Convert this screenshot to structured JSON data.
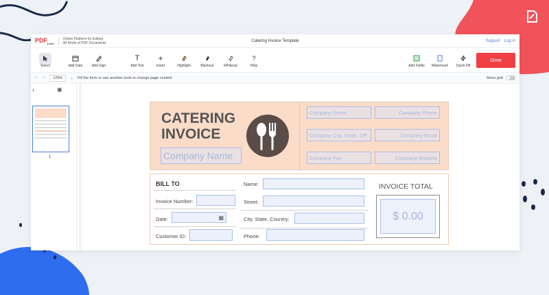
{
  "app": {
    "logo": "PDF",
    "logo_sub": "Liner",
    "tagline_1": "Online Platform for Editing",
    "tagline_2": "All Kinds of PDF Documents",
    "document_title": "Catering Invoice Template",
    "support": "Support",
    "login": "Log in"
  },
  "toolbar": {
    "select": "Select",
    "add_date": "Add Date",
    "add_sign": "Add Sign",
    "add_text": "Add Text",
    "insert": "Insert",
    "highlight": "Highlight",
    "blackout": "Blackout",
    "whiteout": "Whiteout",
    "help": "Help",
    "add_fields": "Add Fields",
    "watermark": "Watermark",
    "quick_fill": "Quick Fill",
    "done": "Done"
  },
  "subbar": {
    "zoom": "125%",
    "hint": "Fill the form or use another tools to change page content",
    "show_grid": "Show grid"
  },
  "sidebar": {
    "page_number": "1"
  },
  "invoice": {
    "title_line1": "CATERING",
    "title_line2": "INVOICE",
    "company_name": "Company Name",
    "company_street": "Company Street",
    "company_phone": "Company Phone",
    "company_city": "Company City, State, ZIP",
    "company_email": "Company Email",
    "company_fax": "Company Fax",
    "company_website": "Company Website",
    "bill_to": "BILL TO",
    "invoice_number": "Invoice Number:",
    "date": "Date:",
    "customer_id": "Customer ID:",
    "name": "Name:",
    "street": "Street:",
    "city_state_country": "City, State, Country:",
    "phone": "Phone:",
    "invoice_total": "INVOICE TOTAL",
    "total_amount": "$ 0.00"
  },
  "colors": {
    "accent": "#ef3f44",
    "header_bg": "#fadcc8",
    "field_border": "#a9bfe8",
    "deco_blue": "#2f6df0",
    "deco_navy": "#1a2a4a"
  }
}
